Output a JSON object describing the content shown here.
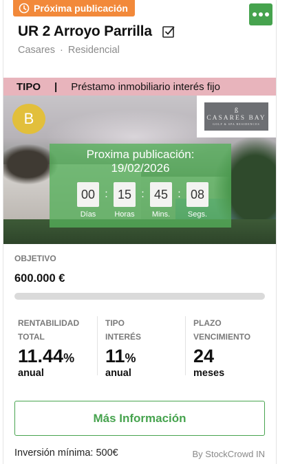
{
  "badge": {
    "label": "Próxima publicación",
    "icon": "clock-icon",
    "color": "#f2893a"
  },
  "menu": {
    "icon": "more-dots-icon",
    "color": "#46a34e"
  },
  "project": {
    "title": "UR 2 Arroyo Parrilla",
    "title_icon": "checkbox-icon",
    "location": "Casares",
    "location_separator": "·",
    "category": "Residencial"
  },
  "tipo": {
    "label": "TIPO",
    "separator": "|",
    "value": "Préstamo inmobiliario interés fijo",
    "color": "#e8b4bc"
  },
  "hero": {
    "rating": "B",
    "rating_color": "#e2bf3b",
    "logo": {
      "mark": "ß",
      "name": "CASARES BAY",
      "sub": "GOLF & SPA RESIDENCES"
    },
    "countdown": {
      "title": "Proxima publicación:",
      "date": "19/02/2026",
      "units": [
        {
          "value": "00",
          "label": "Días"
        },
        {
          "value": "15",
          "label": "Horas"
        },
        {
          "value": "45",
          "label": "Mins."
        },
        {
          "value": "08",
          "label": "Segs."
        }
      ],
      "separator": ":"
    }
  },
  "objetivo": {
    "label": "OBJETIVO",
    "value": "600.000 €",
    "progress": 0
  },
  "stats": [
    {
      "label": "RENTABILIDAD\nTOTAL",
      "value": "11.44",
      "unit": "%",
      "sub": "anual"
    },
    {
      "label": "TIPO\nINTERÉS",
      "value": "11",
      "unit": "%",
      "sub": "anual"
    },
    {
      "label": "PLAZO\nVENCIMIENTO",
      "value": "24",
      "unit": "",
      "sub": "meses"
    }
  ],
  "cta": {
    "label": "Más Información",
    "color": "#46a34e"
  },
  "footer": {
    "min_investment": "Inversión mínima: 500€",
    "provider": "By StockCrowd IN"
  }
}
